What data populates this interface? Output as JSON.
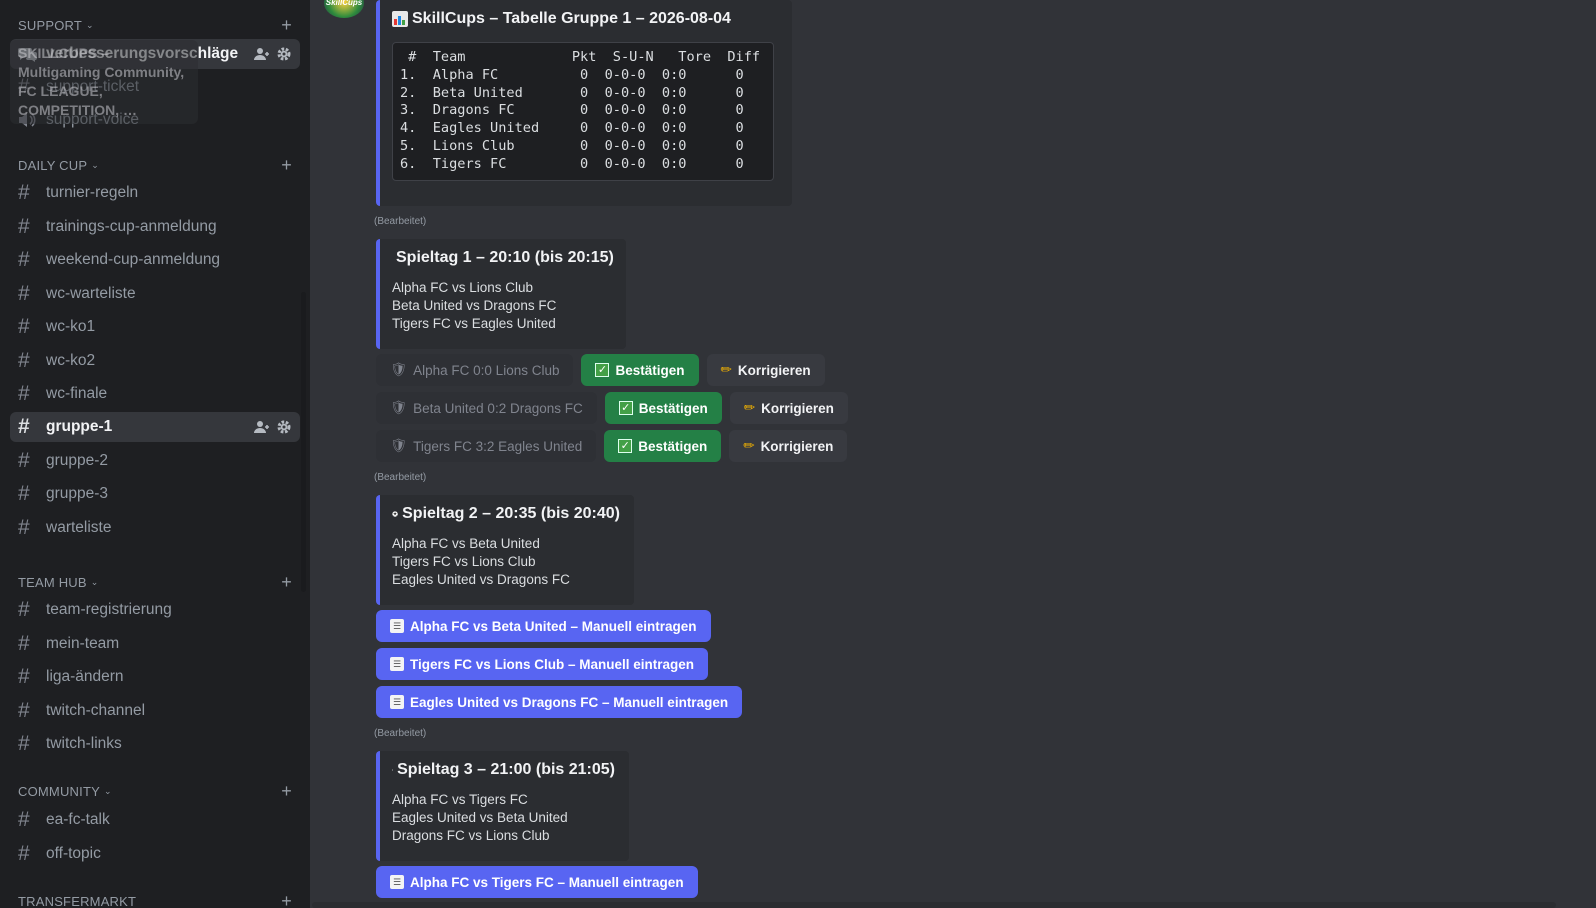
{
  "sidebar": {
    "categories": {
      "support": "SUPPORT",
      "daily_cup": "DAILY CUP",
      "team_hub": "TEAM HUB",
      "community": "COMMUNITY",
      "transfermarkt": "TRANSFERMARKT"
    },
    "tooltip_text": "SKILLCUPS – Multigaming Community, FC LEAGUE, COMPETITION, …",
    "channels": {
      "verbesserungsvorschlaege": "verbesserungsvorschläge",
      "support_ticket": "support-ticket",
      "support_voice": "support-voice",
      "turnier_regeln": "turnier-regeln",
      "trainings_cup": "trainings-cup-anmeldung",
      "weekend_cup": "weekend-cup-anmeldung",
      "wc_warteliste": "wc-warteliste",
      "wc_ko1": "wc-ko1",
      "wc_ko2": "wc-ko2",
      "wc_finale": "wc-finale",
      "gruppe_1": "gruppe-1",
      "gruppe_2": "gruppe-2",
      "gruppe_3": "gruppe-3",
      "warteliste": "warteliste",
      "team_registrierung": "team-registrierung",
      "mein_team": "mein-team",
      "liga_aendern": "liga-ändern",
      "twitch_channel": "twitch-channel",
      "twitch_links": "twitch-links",
      "ea_fc_talk": "ea-fc-talk",
      "off_topic": "off-topic"
    }
  },
  "main": {
    "avatar_text": "SkillCups",
    "edited_label": "(Bearbeitet)",
    "table_embed": {
      "title": "SkillCups – Tabelle Gruppe 1 – 2026-08-04",
      "table": " #  Team             Pkt  S-U-N   Tore  Diff\n1.  Alpha FC          0  0-0-0  0:0      0\n2.  Beta United       0  0-0-0  0:0      0\n3.  Dragons FC        0  0-0-0  0:0      0\n4.  Eagles United     0  0-0-0  0:0      0\n5.  Lions Club        0  0-0-0  0:0      0\n6.  Tigers FC         0  0-0-0  0:0      0"
    },
    "matchday1": {
      "title": "Spieltag 1 – 20:10 (bis 20:15)",
      "matches": [
        "Alpha FC vs Lions Club",
        "Beta United vs Dragons FC",
        "Tigers FC vs Eagles United"
      ],
      "results": [
        {
          "label": "Alpha FC 0:0 Lions Club",
          "confirm": "Bestätigen",
          "correct": "Korrigieren"
        },
        {
          "label": "Beta United 0:2 Dragons FC",
          "confirm": "Bestätigen",
          "correct": "Korrigieren"
        },
        {
          "label": "Tigers FC 3:2 Eagles United",
          "confirm": "Bestätigen",
          "correct": "Korrigieren"
        }
      ]
    },
    "matchday2": {
      "title": "Spieltag 2 – 20:35 (bis 20:40)",
      "matches": [
        "Alpha FC vs Beta United",
        "Tigers FC vs Lions Club",
        "Eagles United vs Dragons FC"
      ],
      "buttons": [
        "Alpha FC vs Beta United – Manuell eintragen",
        "Tigers FC vs Lions Club – Manuell eintragen",
        "Eagles United vs Dragons FC – Manuell eintragen"
      ]
    },
    "matchday3": {
      "title": "Spieltag 3 – 21:00 (bis 21:05)",
      "matches": [
        "Alpha FC vs Tigers FC",
        "Eagles United vs Beta United",
        "Dragons FC vs Lions Club"
      ],
      "buttons": [
        "Alpha FC vs Tigers FC – Manuell eintragen"
      ]
    }
  },
  "colors": {
    "accent": "#5865f2",
    "success": "#248046",
    "background": "#313338",
    "sidebar": "#1e1f22"
  }
}
